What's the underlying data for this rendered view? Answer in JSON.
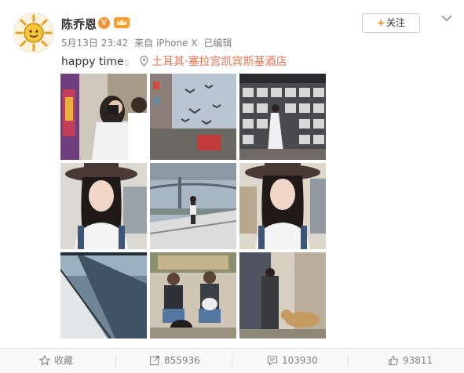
{
  "post": {
    "author_name": "陈乔恩",
    "verified_badge": "V",
    "crown_icon": "crown-icon",
    "date": "5月13日 23:42",
    "source": "来自 iPhone X",
    "edited": "已编辑",
    "follow_label": "关注",
    "follow_plus": "+",
    "text": "happy time",
    "location": "土耳其·塞拉宫凯宾斯基酒店"
  },
  "photos": [
    {
      "name": "photo-camera-crowd"
    },
    {
      "name": "photo-seagulls-street"
    },
    {
      "name": "photo-market-wall"
    },
    {
      "name": "photo-selfie-hat-1"
    },
    {
      "name": "photo-bridge-boat"
    },
    {
      "name": "photo-selfie-hat-2"
    },
    {
      "name": "photo-sea-deck"
    },
    {
      "name": "photo-drummers"
    },
    {
      "name": "photo-street-dog"
    }
  ],
  "footer": {
    "favorite_label": "收藏",
    "repost_count": "855936",
    "comment_count": "103930",
    "like_count": "93811"
  },
  "colors": {
    "accent": "#ff8200",
    "location": "#eb7350",
    "muted": "#808080"
  }
}
